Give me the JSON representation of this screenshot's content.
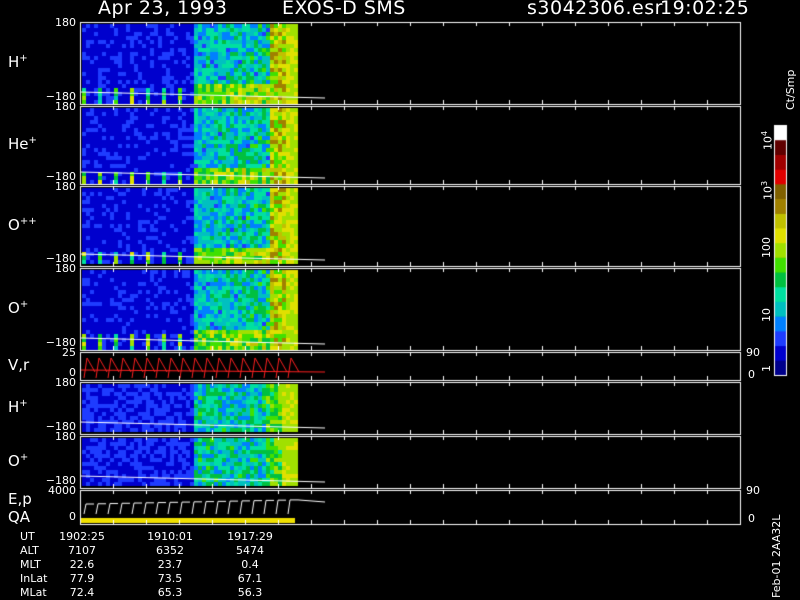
{
  "header": {
    "date": "Apr 23, 1993",
    "instrument": "EXOS-D SMS",
    "file": "s3042306.esr",
    "time": "19:02:25"
  },
  "panels": [
    {
      "id": "h-plus-1",
      "label": "H",
      "sup": "+",
      "ytop": "180",
      "ybot": "−180"
    },
    {
      "id": "he-plus",
      "label": "He",
      "sup": "+",
      "ytop": "180",
      "ybot": "−180"
    },
    {
      "id": "o-plus-plus",
      "label": "O",
      "sup": "++",
      "ytop": "180",
      "ybot": "−180"
    },
    {
      "id": "o-plus-1",
      "label": "O",
      "sup": "+",
      "ytop": "180",
      "ybot": "−180"
    },
    {
      "id": "vr",
      "label": "V,r",
      "sup": "",
      "ytop": "25",
      "ybot": "0",
      "rtop": "90",
      "rbot": "0"
    },
    {
      "id": "h-plus-2",
      "label": "H",
      "sup": "+",
      "ytop": "180",
      "ybot": "−180"
    },
    {
      "id": "o-plus-2",
      "label": "O",
      "sup": "+",
      "ytop": "180",
      "ybot": "−180"
    },
    {
      "id": "ep",
      "label": "E,p",
      "label2": "QA",
      "sup": "",
      "ytop": "4000",
      "ybot": "0",
      "rtop": "90",
      "rbot": "0"
    }
  ],
  "colorbar": {
    "title": "Ct/Smp",
    "ticks": [
      "1",
      "10",
      "100",
      "10",
      "10"
    ],
    "tick_sups": [
      "",
      "",
      "",
      "3",
      "4"
    ],
    "colors": [
      "#00008b",
      "#0000cd",
      "#1e3cff",
      "#0080ff",
      "#00c0c0",
      "#00e0a0",
      "#00c040",
      "#40e000",
      "#a0e000",
      "#e0e000",
      "#c0c000",
      "#a08000",
      "#806000",
      "#e00000",
      "#a00000",
      "#600000",
      "#ffffff"
    ]
  },
  "time_axis": {
    "labels": [
      "UT",
      "ALT",
      "MLT",
      "InLat",
      "MLat"
    ],
    "columns": [
      {
        "UT": "1902:25",
        "ALT": "7107",
        "MLT": "22.6",
        "InLat": "77.9",
        "MLat": "72.4"
      },
      {
        "UT": "1910:01",
        "ALT": "6352",
        "MLT": "23.7",
        "InLat": "73.5",
        "MLat": "65.3"
      },
      {
        "UT": "1917:29",
        "ALT": "5474",
        "MLT": "0.4",
        "InLat": "67.1",
        "MLat": "56.3"
      }
    ]
  },
  "footer": {
    "stamp": "Feb-01 2AA32L"
  },
  "chart_data": {
    "type": "heatmap",
    "title": "Apr 23, 1993   EXOS-D SMS",
    "x_labels": [
      "1902:25",
      "1910:01",
      "1917:29"
    ],
    "panels": [
      "H+",
      "He+",
      "O++",
      "O+",
      "V,r",
      "H+",
      "O+",
      "E,p / QA"
    ],
    "y_range_angle": [
      -180,
      180
    ],
    "y_range_vr": [
      0,
      25
    ],
    "y_range_ep": [
      0,
      4000
    ],
    "right_axis": [
      0,
      90
    ],
    "colorbar_scale": "log",
    "colorbar_range": [
      1,
      10000
    ],
    "colorbar_unit": "Ct/Smp"
  }
}
